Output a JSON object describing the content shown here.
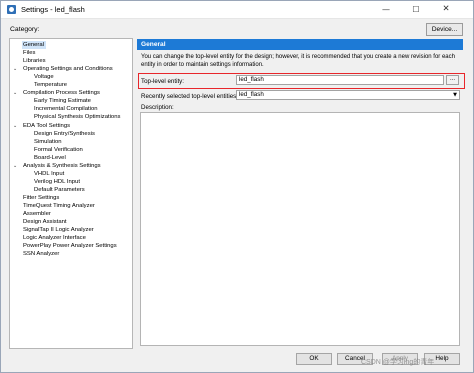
{
  "window": {
    "title": "Settings - led_flash",
    "minimize_glyph": "—",
    "maximize_glyph": "☐",
    "close_glyph": "✕"
  },
  "category_label": "Category:",
  "device_button": "Device...",
  "tree": [
    {
      "label": "General",
      "level": 0,
      "arrow": "",
      "selected": true
    },
    {
      "label": "Files",
      "level": 0,
      "arrow": ""
    },
    {
      "label": "Libraries",
      "level": 0,
      "arrow": ""
    },
    {
      "label": "Operating Settings and Conditions",
      "level": 0,
      "arrow": "⌄"
    },
    {
      "label": "Voltage",
      "level": 1,
      "arrow": ""
    },
    {
      "label": "Temperature",
      "level": 1,
      "arrow": ""
    },
    {
      "label": "Compilation Process Settings",
      "level": 0,
      "arrow": "⌄"
    },
    {
      "label": "Early Timing Estimate",
      "level": 1,
      "arrow": ""
    },
    {
      "label": "Incremental Compilation",
      "level": 1,
      "arrow": ""
    },
    {
      "label": "Physical Synthesis Optimizations",
      "level": 1,
      "arrow": ""
    },
    {
      "label": "EDA Tool Settings",
      "level": 0,
      "arrow": "⌄"
    },
    {
      "label": "Design Entry/Synthesis",
      "level": 1,
      "arrow": ""
    },
    {
      "label": "Simulation",
      "level": 1,
      "arrow": ""
    },
    {
      "label": "Formal Verification",
      "level": 1,
      "arrow": ""
    },
    {
      "label": "Board-Level",
      "level": 1,
      "arrow": ""
    },
    {
      "label": "Analysis & Synthesis Settings",
      "level": 0,
      "arrow": "⌄"
    },
    {
      "label": "VHDL Input",
      "level": 1,
      "arrow": ""
    },
    {
      "label": "Verilog HDL Input",
      "level": 1,
      "arrow": ""
    },
    {
      "label": "Default Parameters",
      "level": 1,
      "arrow": ""
    },
    {
      "label": "Fitter Settings",
      "level": 0,
      "arrow": ""
    },
    {
      "label": "TimeQuest Timing Analyzer",
      "level": 0,
      "arrow": ""
    },
    {
      "label": "Assembler",
      "level": 0,
      "arrow": ""
    },
    {
      "label": "Design Assistant",
      "level": 0,
      "arrow": ""
    },
    {
      "label": "SignalTap II Logic Analyzer",
      "level": 0,
      "arrow": ""
    },
    {
      "label": "Logic Analyzer Interface",
      "level": 0,
      "arrow": ""
    },
    {
      "label": "PowerPlay Power Analyzer Settings",
      "level": 0,
      "arrow": ""
    },
    {
      "label": "SSN Analyzer",
      "level": 0,
      "arrow": ""
    }
  ],
  "panel": {
    "heading": "General",
    "description": "You can change the top-level entity for the design; however, it is recommended that you create a new revision for each entity in order to maintain settings information.",
    "top_level_label": "Top-level entity:",
    "top_level_value": "led_flash",
    "browse_label": "...",
    "recent_label": "Recently selected top-level entities:",
    "recent_value": "led_flash",
    "recent_arrow": "▼",
    "desc_label": "Description:"
  },
  "buttons": {
    "ok": "OK",
    "cancel": "Cancel",
    "apply": "Apply",
    "help": "Help"
  },
  "watermark": "CSDN @学习ing的青年",
  "colors": {
    "accent": "#1d7ad6",
    "highlight": "#e8262b",
    "selection": "#cfe3f8"
  }
}
